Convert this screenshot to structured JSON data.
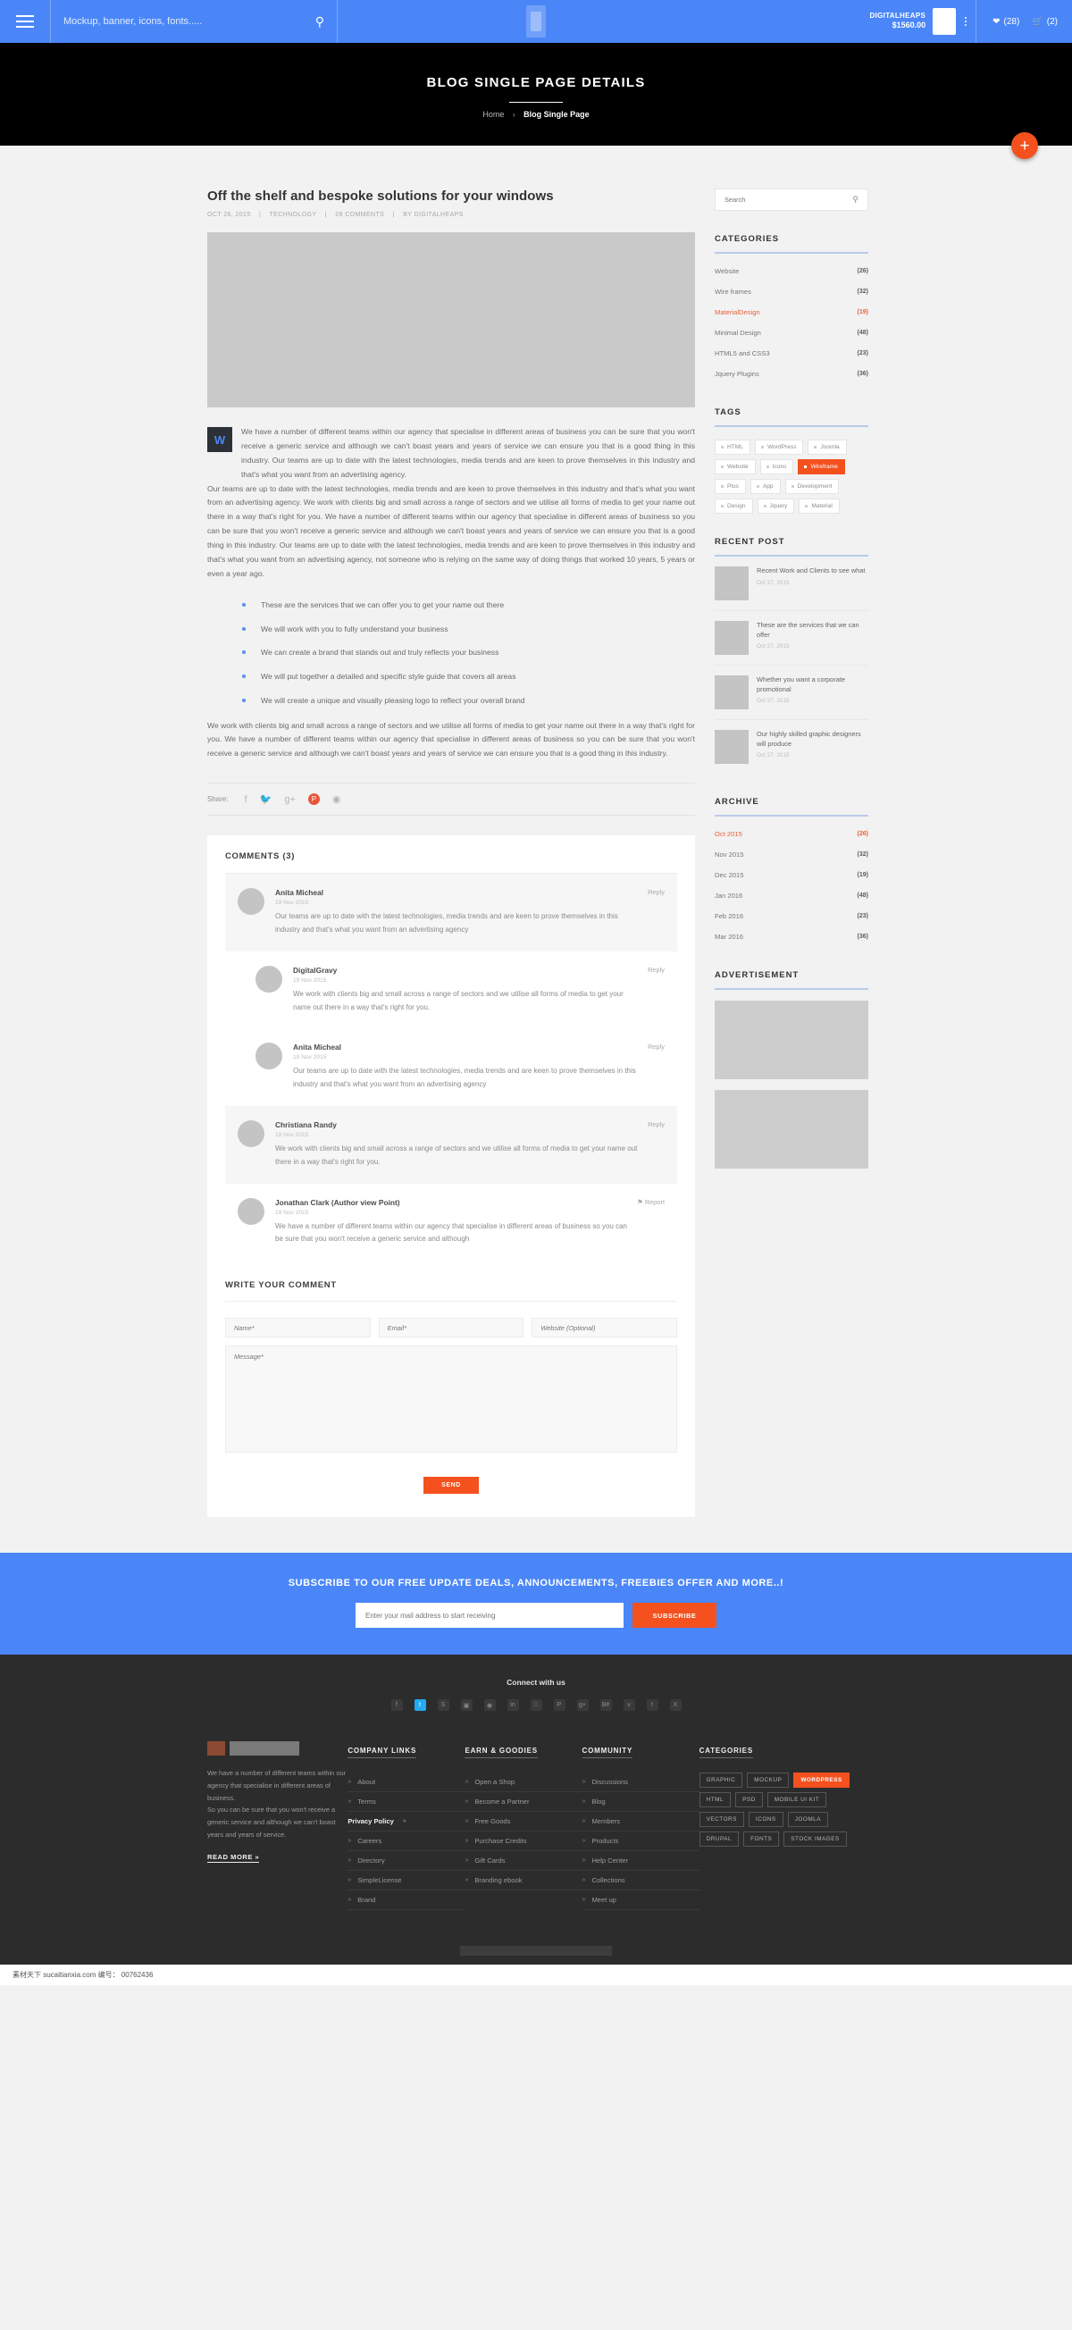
{
  "topbar": {
    "menu_icon": "hamburger-icon",
    "search_placeholder": "Mockup, banner, icons, fonts.....",
    "search_icon": "search-icon",
    "account_name": "DIGITALHEAPS",
    "account_amount": "$1560.00",
    "wishlist_count": "(28)",
    "cart_count": "(2)",
    "heart_icon": "heart-icon",
    "cart_icon": "cart-icon"
  },
  "hero": {
    "title": "BLOG SINGLE PAGE DETAILS",
    "breadcrumb_home": "Home",
    "breadcrumb_sep": "›",
    "breadcrumb_current": "Blog Single Page",
    "fab_label": "+"
  },
  "post": {
    "title": "Off the shelf and bespoke solutions for your windows",
    "date": "OCT 26, 2015",
    "category": "TECHNOLOGY",
    "comments": "28 COMMENTS",
    "author": "BY DIGITALHEAPS",
    "dropcap": "W",
    "lead": "We have a number of different teams within our agency that specialise in different areas of business you can be sure that you won't receive a generic service and although we can't boast years and years of service we can ensure you that is a good thing in this industry. Our teams are up to date with the latest technologies, media trends and are keen to prove themselves in this industry and that's what you want from an advertising agency.",
    "paragraph2": " Our teams are up to date with the latest technologies, media trends and are keen to prove themselves in this industry and that's what you want from an advertising agency. We work with clients big and small across a range of sectors and we utilise all forms of media to get your name out there in a way that's right for you. We have a number of different teams within our agency that specialise in different areas of business so you can be sure that you won't receive a generic service and although we can't boast years and years of service we can ensure you that is a good thing in this industry. Our teams are up to date with the latest technologies, media trends and are keen to prove themselves in this industry and that's what you want from an advertising agency, not someone who is relying on the same way of doing things that worked 10 years, 5 years or even a year ago.",
    "bullets": [
      "These are the services that we can offer you to get your name out there",
      "We will work with you to fully understand your business",
      "We can create a brand that stands out and truly reflects your business",
      "We will put together a detailed and specific style guide that covers all areas",
      "We will create a unique and visually pleasing logo to reflect your overall brand"
    ],
    "paragraph3": "  We work with clients big and small across a range of sectors and we utilise all forms of media to get your name out there in a way that's right for you. We have a number of different teams within our agency that specialise in different areas of business so you can be sure that you won't receive a generic service and although we can't boast years and years of service we can ensure you that is a good thing in this industry.",
    "share_label": "Share:",
    "share_icons": [
      "facebook-icon",
      "twitter-icon",
      "google-plus-icon",
      "pinterest-icon",
      "dribbble-icon"
    ]
  },
  "comments": {
    "heading": "COMMENTS (3)",
    "items": [
      {
        "name": "Anita Micheal",
        "date": "19 Nov 2015",
        "text": "Our teams are up to date with the latest technologies, media trends and are keen to prove themselves in this industry and that's what you want from an advertising agency",
        "action": "Reply"
      },
      {
        "name": "DigitalGravy",
        "date": "19 Nov 2015",
        "text": "We work with clients big and small across a range of sectors and we utilise all forms of media to get your name out there in a way that's right for you.",
        "action": "Reply"
      },
      {
        "name": "Anita Micheal",
        "date": "19 Nov 2015",
        "text": "Our teams are up to date with the latest technologies, media trends and are keen to prove themselves in this industry and that's what you want from an advertising agency",
        "action": "Reply"
      },
      {
        "name": "Christiana Randy",
        "date": "19 Nov 2015",
        "text": "We work with clients big and small across a range of sectors and we utilise all forms of media to get your name out there in a way that's right for you.",
        "action": "Reply"
      },
      {
        "name": "Jonathan Clark (Author view Point)",
        "date": "19 Nov 2015",
        "text": "We have a number of different teams within our agency that specialise in different areas of business so you can be sure that you won't receive a generic service and although",
        "action": "Report"
      }
    ]
  },
  "comment_form": {
    "heading": "WRITE YOUR COMMENT",
    "name_placeholder": "Name*",
    "email_placeholder": "Email*",
    "website_placeholder": "Website (Optional)",
    "message_placeholder": "Message*",
    "submit_label": "SEND"
  },
  "sidebar": {
    "search_placeholder": "Search",
    "search_icon": "search-icon",
    "categories_title": "CATEGORIES",
    "categories": [
      {
        "label": "Website",
        "count": "(26)",
        "active": false
      },
      {
        "label": "Wire frames",
        "count": "(32)",
        "active": false
      },
      {
        "label": "MaterialDesign",
        "count": "(19)",
        "active": true
      },
      {
        "label": "Minimal Design",
        "count": "(48)",
        "active": false
      },
      {
        "label": "HTML5 and CSS3",
        "count": "(23)",
        "active": false
      },
      {
        "label": "Jquery Plugins",
        "count": "(36)",
        "active": false
      }
    ],
    "tags_title": "TAGS",
    "tags": [
      {
        "label": "HTML",
        "active": false
      },
      {
        "label": "WordPress",
        "active": false
      },
      {
        "label": "Joomla",
        "active": false
      },
      {
        "label": "Website",
        "active": false
      },
      {
        "label": "Icons",
        "active": false
      },
      {
        "label": "Wireframe",
        "active": true
      },
      {
        "label": "Plus",
        "active": false
      },
      {
        "label": "App",
        "active": false
      },
      {
        "label": "Development",
        "active": false
      },
      {
        "label": "Design",
        "active": false
      },
      {
        "label": "Jquery",
        "active": false
      },
      {
        "label": "Material",
        "active": false
      }
    ],
    "recent_title": "RECENT POST",
    "recent_posts": [
      {
        "title": "Recent Work and Clients to see what",
        "date": "Oct 27, 2015"
      },
      {
        "title": "These are the services that we can offer",
        "date": "Oct 27, 2015"
      },
      {
        "title": "Whether you want a corporate promotional",
        "date": "Oct 27, 2015"
      },
      {
        "title": "Our highly skilled graphic designers will produce",
        "date": "Oct 27, 2015"
      }
    ],
    "archive_title": "ARCHIVE",
    "archive": [
      {
        "label": "Oct 2015",
        "count": "(26)",
        "active": true
      },
      {
        "label": "Nov 2015",
        "count": "(32)",
        "active": false
      },
      {
        "label": "Dec 2015",
        "count": "(19)",
        "active": false
      },
      {
        "label": "Jan 2016",
        "count": "(48)",
        "active": false
      },
      {
        "label": "Feb 2016",
        "count": "(23)",
        "active": false
      },
      {
        "label": "Mar 2016",
        "count": "(36)",
        "active": false
      }
    ],
    "advertisement_title": "ADVERTISEMENT"
  },
  "subscribe": {
    "heading": "SUBSCRIBE TO OUR FREE UPDATE DEALS, ANNOUNCEMENTS, FREEBIES OFFER AND MORE..!",
    "placeholder": "Enter your mail address to start receiving",
    "button": "SUBSCRIBE"
  },
  "footer": {
    "connect_title": "Connect with us",
    "socials": [
      "facebook-icon",
      "twitter-icon",
      "skype-icon",
      "instagram-icon",
      "dribbble-icon",
      "linkedin-icon",
      "apple-icon",
      "pinterest-icon",
      "google-plus-icon",
      "behance-icon",
      "vimeo-icon",
      "tumblr-icon",
      "xing-icon"
    ],
    "about_text": "We have a number of different teams within our agency that specialise in different areas of business.\nSo you can be sure that you won't receive a generic service and although we can't boast years and years of service.",
    "read_more": "READ MORE »",
    "company_links_title": "COMPANY LINKS",
    "company_links": [
      {
        "label": "About",
        "highlight": false
      },
      {
        "label": "Terms",
        "highlight": false
      },
      {
        "label": "Privacy Policy",
        "highlight": true
      },
      {
        "label": "Careers",
        "highlight": false
      },
      {
        "label": "Directory",
        "highlight": false
      },
      {
        "label": "SimpleLicense",
        "highlight": false
      },
      {
        "label": "Brand",
        "highlight": false
      }
    ],
    "earn_title": "EARN & GOODIES",
    "earn_links": [
      {
        "label": "Open a Shop"
      },
      {
        "label": "Become a Partner"
      },
      {
        "label": "Free Goods"
      },
      {
        "label": "Purchase Credits"
      },
      {
        "label": "Gift Cards"
      },
      {
        "label": "Branding ebook"
      }
    ],
    "community_title": "COMMUNITY",
    "community_links": [
      {
        "label": "Discussions"
      },
      {
        "label": "Blog"
      },
      {
        "label": "Members"
      },
      {
        "label": "Products"
      },
      {
        "label": "Help Center"
      },
      {
        "label": "Collections"
      },
      {
        "label": "Meet up"
      }
    ],
    "categories_title": "CATEGORIES",
    "categories": [
      {
        "label": "GRAPHIC",
        "active": false
      },
      {
        "label": "MOCKUP",
        "active": false
      },
      {
        "label": "WORDPRESS",
        "active": true
      },
      {
        "label": "HTML",
        "active": false
      },
      {
        "label": "PSD",
        "active": false
      },
      {
        "label": "MOBILE UI KIT",
        "active": false
      },
      {
        "label": "VECTORS",
        "active": false
      },
      {
        "label": "ICONS",
        "active": false
      },
      {
        "label": "JOOMLA",
        "active": false
      },
      {
        "label": "DRUPAL",
        "active": false
      },
      {
        "label": "FONTS",
        "active": false
      },
      {
        "label": "STOCK IMAGES",
        "active": false
      }
    ]
  },
  "watermark": {
    "text": "素材天下 sucaitianxia.com   编号： 00762436"
  },
  "colors": {
    "primary_blue": "#4a86f7",
    "accent_orange": "#f4511e",
    "dark": "#2c2c2c"
  }
}
